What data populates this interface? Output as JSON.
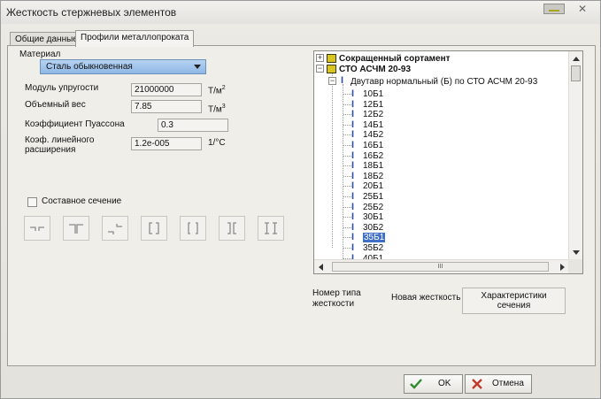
{
  "window": {
    "title": "Жесткость стержневых элементов",
    "close_glyph": "✕"
  },
  "tabs": [
    {
      "label": "Общие данные",
      "active": false
    },
    {
      "label": "Профили металлопроката",
      "active": true
    }
  ],
  "material": {
    "group_label": "Материал",
    "selected": "Сталь обыкновенная"
  },
  "fields": [
    {
      "label_lines": [
        "Модуль упругости"
      ],
      "value": "21000000",
      "unit": "Т/м",
      "unit_sup": "2"
    },
    {
      "label_lines": [
        "Объемный вес"
      ],
      "value": "7.85",
      "unit": "Т/м",
      "unit_sup": "3"
    },
    {
      "label_lines": [
        "Коэффициент Пуассона"
      ],
      "value": "0.3",
      "unit": "",
      "unit_sup": ""
    },
    {
      "label_lines": [
        "Коэф. линейного",
        "расширения"
      ],
      "value": "1.2e-005",
      "unit": "1/°C",
      "unit_sup": ""
    }
  ],
  "composite": {
    "label": "Составное сечение",
    "checked": false
  },
  "section_buttons": [
    "section-angle-pair",
    "section-tee-pair",
    "section-angle-cross",
    "section-channel-box",
    "section-channel-back",
    "section-channel-face",
    "section-ibeam-pair"
  ],
  "tree": {
    "roots": [
      {
        "label": "Сокращенный сортамент",
        "expanded": false
      },
      {
        "label": "СТО АСЧМ 20-93",
        "expanded": true
      }
    ],
    "group": {
      "label": "Двутавр нормальный (Б) по СТО АСЧМ 20-93",
      "expanded": true
    },
    "items": [
      "10Б1",
      "12Б1",
      "12Б2",
      "14Б1",
      "14Б2",
      "16Б1",
      "16Б2",
      "18Б1",
      "18Б2",
      "20Б1",
      "25Б1",
      "25Б2",
      "30Б1",
      "30Б2",
      "35Б1",
      "35Б2",
      "40Б1"
    ],
    "selected_item": "35Б1",
    "hscroll_grip": "III"
  },
  "columns": {
    "type_number": [
      "Номер типа",
      "жесткости"
    ],
    "new_stiffness": "Новая жесткость",
    "characteristics": [
      "Характеристики",
      "сечения"
    ]
  },
  "buttons": {
    "ok": "OK",
    "cancel": "Отмена"
  },
  "colors": {
    "selection": "#3f6fc6",
    "combo": "#9fc3ec",
    "ok_icon": "#2e8b2e",
    "cancel_icon": "#c0392b"
  }
}
